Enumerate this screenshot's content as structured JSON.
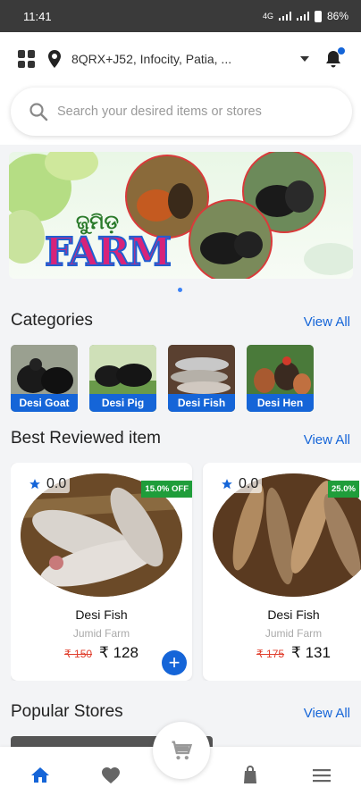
{
  "status_bar": {
    "time": "11:41",
    "network": "4G",
    "battery": "86%"
  },
  "header": {
    "location": "8QRX+J52, Infocity, Patia, ..."
  },
  "search": {
    "placeholder": "Search your desired items or stores"
  },
  "banner": {
    "logo_script": "ଜୁମିଡ଼",
    "logo_text": "FARM"
  },
  "categories": {
    "title": "Categories",
    "view_all": "View All",
    "items": [
      {
        "label": "Desi Goat"
      },
      {
        "label": "Desi Pig"
      },
      {
        "label": "Desi Fish"
      },
      {
        "label": "Desi Hen"
      }
    ]
  },
  "best_reviewed": {
    "title": "Best Reviewed item",
    "view_all": "View All",
    "items": [
      {
        "rating": "0.0",
        "discount": "15.0% OFF",
        "name": "Desi Fish",
        "store": "Jumid Farm",
        "old_price": "₹ 150",
        "price": "₹ 128"
      },
      {
        "rating": "0.0",
        "discount": "25.0%",
        "name": "Desi Fish",
        "store": "Jumid Farm",
        "old_price": "₹ 175",
        "price": "₹ 131"
      }
    ]
  },
  "popular_stores": {
    "title": "Popular Stores",
    "view_all": "View All"
  },
  "colors": {
    "accent": "#1565d8",
    "discount": "#1f9d3a",
    "old_price": "#e0402f"
  },
  "icons": {
    "nav": [
      "home-icon",
      "heart-icon",
      "cart-icon",
      "bag-icon",
      "menu-icon"
    ]
  }
}
